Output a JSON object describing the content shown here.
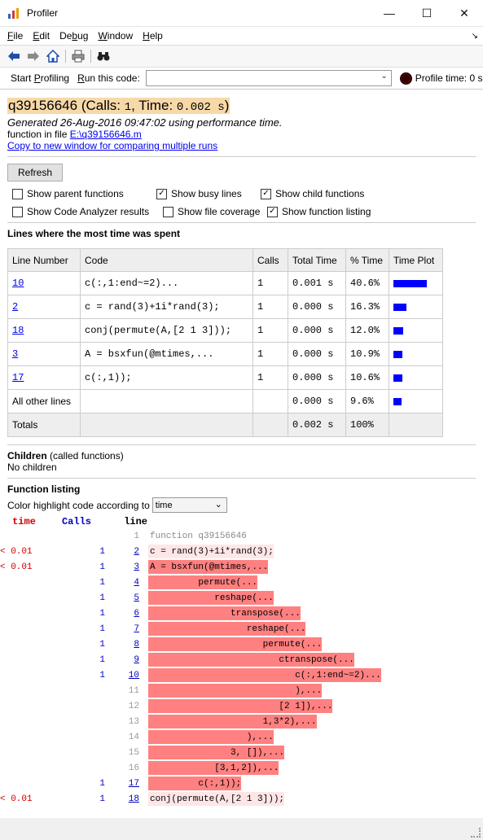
{
  "window": {
    "title": "Profiler",
    "min": "—",
    "max": "☐",
    "close": "✕"
  },
  "menu": [
    {
      "label": "File",
      "ul": "F",
      "rest": "ile"
    },
    {
      "label": "Edit",
      "ul": "E",
      "rest": "dit"
    },
    {
      "label": "Debug",
      "pre": "De",
      "ul": "b",
      "rest": "ug"
    },
    {
      "label": "Window",
      "ul": "W",
      "rest": "indow"
    },
    {
      "label": "Help",
      "ul": "H",
      "rest": "elp"
    }
  ],
  "runbar": {
    "start_pre": "Start ",
    "start_ul": "P",
    "start_rest": "rofiling",
    "run_pre": "",
    "run_ul": "R",
    "run_rest": "un this code:",
    "run_value": "",
    "profile_time": "Profile time: 0 s"
  },
  "header": {
    "func": "q39156646",
    "calls_label": "Calls",
    "calls_value": "1",
    "time_label": "Time",
    "time_value": "0.002 s",
    "generated_prefix": "Generated ",
    "generated_date": "26-Aug-2016 09:47:02",
    "generated_suffix": " using performance time.",
    "infile_label": "function in file ",
    "file_path": "E:\\q39156646.m",
    "copy_link": "Copy to new window for comparing multiple runs"
  },
  "controls": {
    "refresh": "Refresh",
    "options": [
      {
        "label": "Show parent functions",
        "checked": false
      },
      {
        "label": "Show busy lines",
        "checked": true
      },
      {
        "label": "Show child functions",
        "checked": true
      },
      {
        "label": "Show Code Analyzer results",
        "checked": false
      },
      {
        "label": "Show file coverage",
        "checked": false
      },
      {
        "label": "Show function listing",
        "checked": true
      }
    ]
  },
  "lines_section": {
    "title": "Lines where the most time was spent",
    "headers": [
      "Line Number",
      "Code",
      "Calls",
      "Total Time",
      "% Time",
      "Time Plot"
    ],
    "rows": [
      {
        "line": "10",
        "code": "c(:,1:end~=2)...",
        "calls": "1",
        "total": "0.001 s",
        "pct": "40.6%",
        "frac": 0.406
      },
      {
        "line": "2",
        "code": "c = rand(3)+1i*rand(3);",
        "calls": "1",
        "total": "0.000 s",
        "pct": "16.3%",
        "frac": 0.163
      },
      {
        "line": "18",
        "code": "conj(permute(A,[2 1 3]));",
        "calls": "1",
        "total": "0.000 s",
        "pct": "12.0%",
        "frac": 0.12
      },
      {
        "line": "3",
        "code": "A = bsxfun(@mtimes,...",
        "calls": "1",
        "total": "0.000 s",
        "pct": "10.9%",
        "frac": 0.109
      },
      {
        "line": "17",
        "code": "c(:,1));",
        "calls": "1",
        "total": "0.000 s",
        "pct": "10.6%",
        "frac": 0.106
      }
    ],
    "other": {
      "label": "All other lines",
      "total": "0.000 s",
      "pct": "9.6%",
      "frac": 0.096
    },
    "totals": {
      "label": "Totals",
      "total": "0.002 s",
      "pct": "100%"
    }
  },
  "children": {
    "title": "Children",
    "subtitle": " (called functions)",
    "none": "No children"
  },
  "listing": {
    "title": "Function listing",
    "color_label": "Color highlight code according to",
    "color_value": "time",
    "col_time": "time",
    "col_calls": "Calls",
    "col_line": "line",
    "rows": [
      {
        "time": "",
        "calls": "",
        "line": "1",
        "code": "function q39156646",
        "hl": "gray"
      },
      {
        "time": "< 0.01",
        "calls": "1",
        "line": "2",
        "code": "c = rand(3)+1i*rand(3);",
        "hl": "light"
      },
      {
        "time": "< 0.01",
        "calls": "1",
        "line": "3",
        "code": "A = bsxfun(@mtimes,...",
        "hl": "dark"
      },
      {
        "time": "",
        "calls": "1",
        "line": "4",
        "code": "         permute(...",
        "hl": "dark"
      },
      {
        "time": "",
        "calls": "1",
        "line": "5",
        "code": "            reshape(...",
        "hl": "dark"
      },
      {
        "time": "",
        "calls": "1",
        "line": "6",
        "code": "               transpose(...",
        "hl": "dark"
      },
      {
        "time": "",
        "calls": "1",
        "line": "7",
        "code": "                  reshape(...",
        "hl": "dark"
      },
      {
        "time": "",
        "calls": "1",
        "line": "8",
        "code": "                     permute(...",
        "hl": "dark"
      },
      {
        "time": "",
        "calls": "1",
        "line": "9",
        "code": "                        ctranspose(...",
        "hl": "dark"
      },
      {
        "time": "",
        "calls": "1",
        "line": "10",
        "code": "                           c(:,1:end~=2)...",
        "hl": "dark"
      },
      {
        "time": "",
        "calls": "",
        "line": "11",
        "code": "                           ),...",
        "hl": "dark"
      },
      {
        "time": "",
        "calls": "",
        "line": "12",
        "code": "                        [2 1]),...",
        "hl": "dark"
      },
      {
        "time": "",
        "calls": "",
        "line": "13",
        "code": "                     1,3*2),...",
        "hl": "dark"
      },
      {
        "time": "",
        "calls": "",
        "line": "14",
        "code": "                  ),...",
        "hl": "dark"
      },
      {
        "time": "",
        "calls": "",
        "line": "15",
        "code": "               3, []),...",
        "hl": "dark"
      },
      {
        "time": "",
        "calls": "",
        "line": "16",
        "code": "            [3,1,2]),...",
        "hl": "dark"
      },
      {
        "time": "",
        "calls": "1",
        "line": "17",
        "code": "         c(:,1));",
        "hl": "dark"
      },
      {
        "time": "< 0.01",
        "calls": "1",
        "line": "18",
        "code": "conj(permute(A,[2 1 3]));",
        "hl": "light"
      }
    ]
  }
}
